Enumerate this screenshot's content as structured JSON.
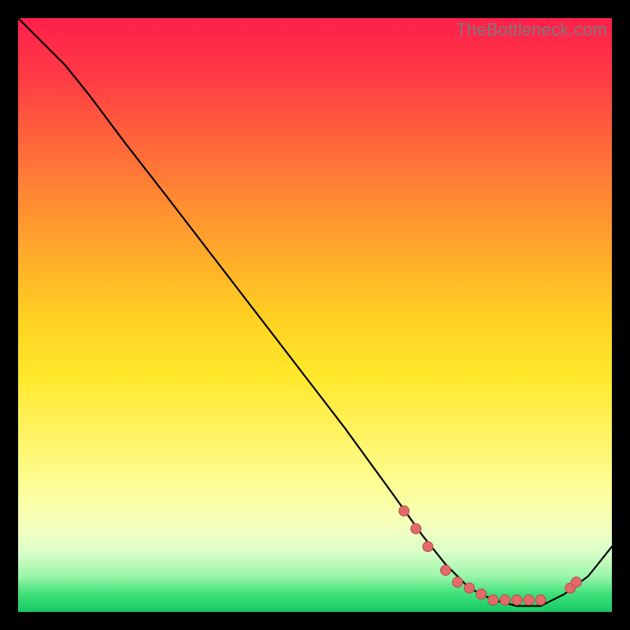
{
  "watermark": "TheBottleneck.com",
  "colors": {
    "curve": "#000000",
    "marker_fill": "#e36a6a",
    "marker_stroke": "#b64c4c"
  },
  "chart_data": {
    "type": "line",
    "title": "",
    "xlabel": "",
    "ylabel": "",
    "xlim": [
      0,
      100
    ],
    "ylim": [
      0,
      100
    ],
    "series": [
      {
        "name": "bottleneck-curve",
        "x": [
          0,
          4,
          8,
          12,
          18,
          25,
          35,
          45,
          55,
          63,
          68,
          72,
          76,
          80,
          84,
          88,
          92,
          96,
          100
        ],
        "y": [
          100,
          96,
          92,
          87,
          79,
          70,
          57,
          44,
          31,
          20,
          13,
          8,
          4,
          2,
          1,
          1,
          3,
          6,
          11
        ]
      }
    ],
    "markers": {
      "name": "highlighted-points",
      "x": [
        65,
        67,
        69,
        72,
        74,
        76,
        78,
        80,
        82,
        84,
        86,
        88,
        93,
        94
      ],
      "y": [
        17,
        14,
        11,
        7,
        5,
        4,
        3,
        2,
        2,
        2,
        2,
        2,
        4,
        5
      ]
    }
  }
}
